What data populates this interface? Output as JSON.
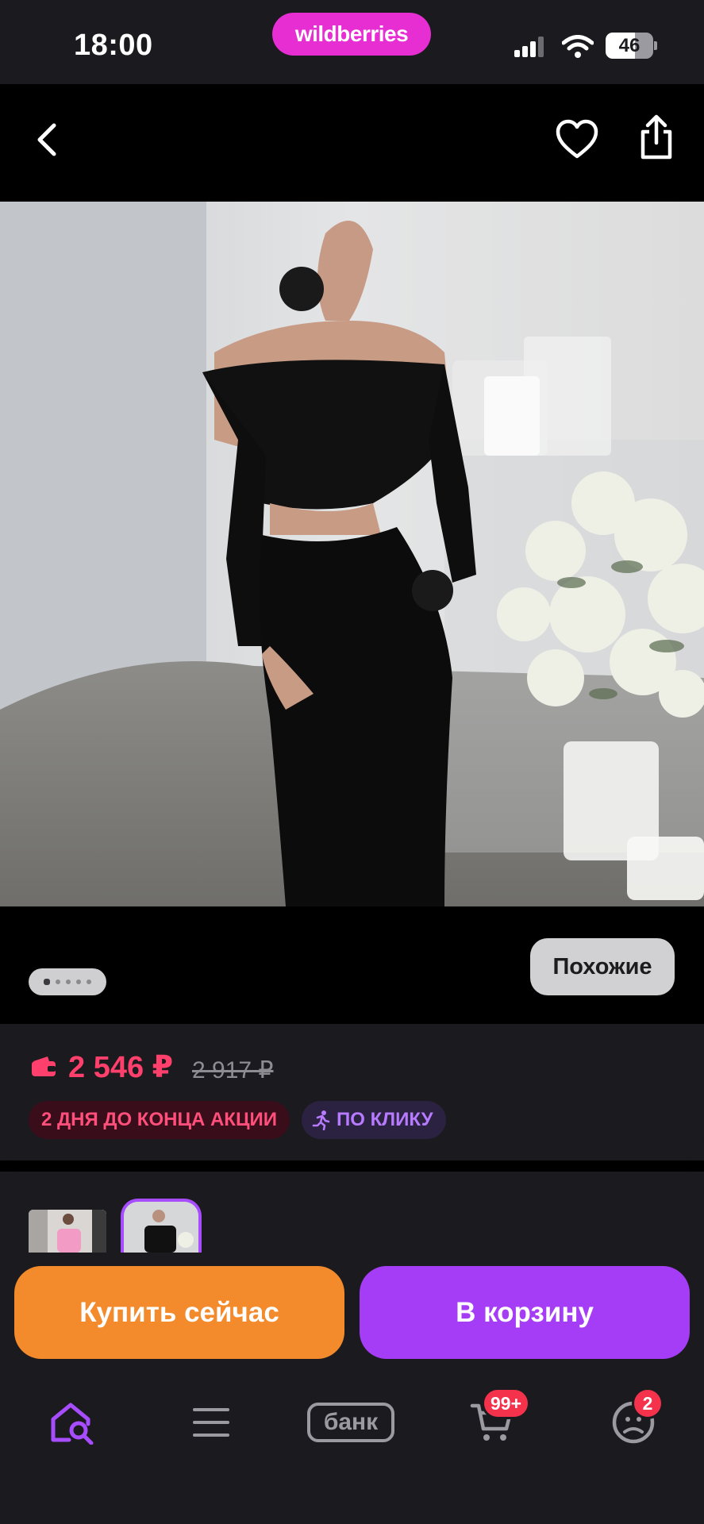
{
  "status_bar": {
    "time": "18:00",
    "brand": "wildberries",
    "battery": "46"
  },
  "header": {
    "back_icon": "chevron-left-icon",
    "favorite_icon": "heart-icon",
    "share_icon": "share-icon"
  },
  "gallery": {
    "image_count": 5,
    "active_index": 0,
    "similar_label": "Похожие"
  },
  "price": {
    "current": "2 546 ₽",
    "old": "2 917 ₽",
    "wallet_icon": "wallet-icon",
    "accent_color": "#ff3f6c",
    "badges": {
      "deadline": "2 ДНЯ ДО КОНЦА АКЦИИ",
      "one_click": "ПО КЛИКУ"
    }
  },
  "variants": {
    "selected_index": 1
  },
  "actions": {
    "buy_now": "Купить сейчас",
    "add_to_cart": "В корзину",
    "buy_color": "#f38a2c",
    "cart_color": "#a43df5"
  },
  "bottom_nav": {
    "home_icon": "home-search-icon",
    "catalog_icon": "menu-icon",
    "bank_label": "банк",
    "cart_icon": "cart-icon",
    "cart_badge": "99+",
    "profile_icon": "profile-icon",
    "profile_badge": "2"
  }
}
